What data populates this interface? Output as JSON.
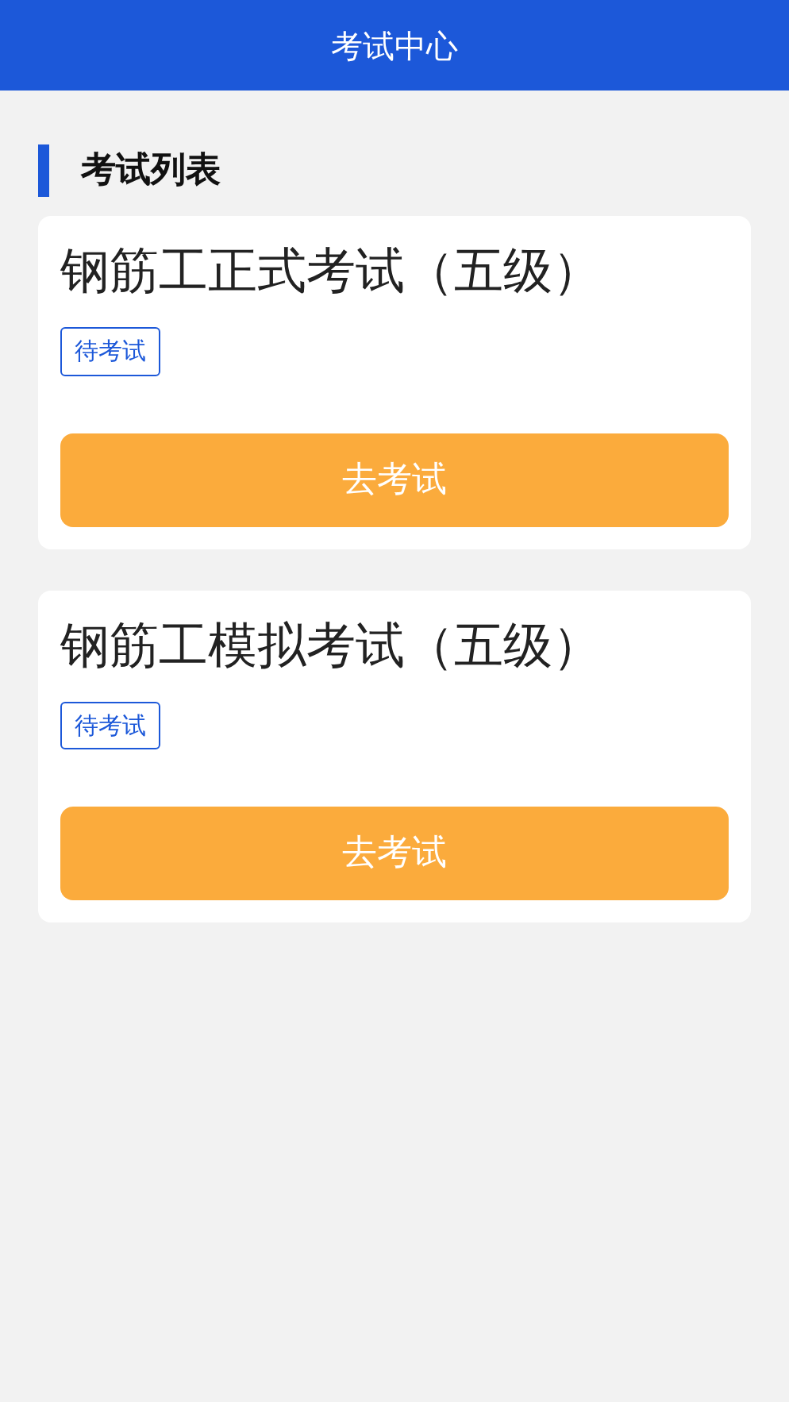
{
  "header": {
    "title": "考试中心"
  },
  "section": {
    "title": "考试列表"
  },
  "exams": [
    {
      "title": "钢筋工正式考试（五级）",
      "status": "待考试",
      "button": "去考试"
    },
    {
      "title": "钢筋工模拟考试（五级）",
      "status": "待考试",
      "button": "去考试"
    }
  ]
}
